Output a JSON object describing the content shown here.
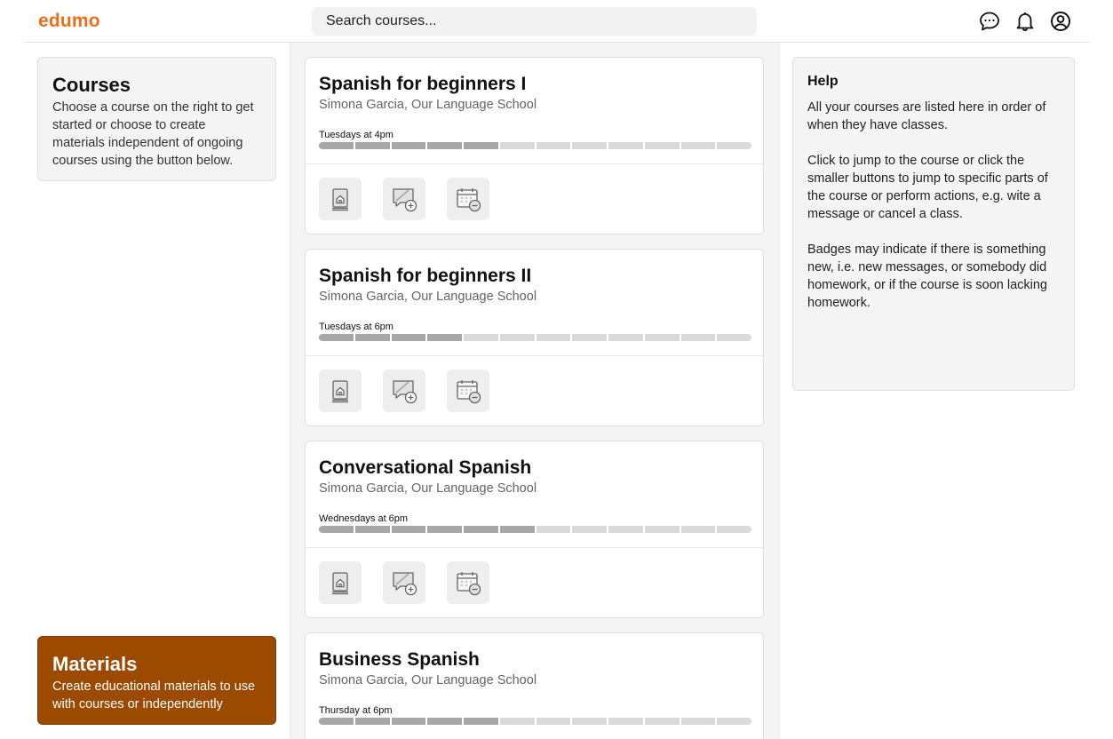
{
  "app": {
    "logo": "edumo",
    "brand_color": "#e8701a"
  },
  "search": {
    "placeholder": "Search courses..."
  },
  "header_icons": [
    "chat-icon",
    "bell-icon",
    "user-account-icon"
  ],
  "left": {
    "courses_title": "Courses",
    "courses_text": "Choose a course on the right to get started or choose to create materials independent of ongoing courses using the button below.",
    "materials_title": "Materials",
    "materials_text": "Create educational materials to use with courses or independently",
    "materials_color": "#9c4a00"
  },
  "courses": [
    {
      "title": "Spanish for beginners I",
      "subtitle": "Simona Garcia, Our Language School",
      "schedule": "Tuesdays at 4pm",
      "progress_filled": 5,
      "progress_total": 12
    },
    {
      "title": "Spanish for beginners II",
      "subtitle": "Simona Garcia, Our Language School",
      "schedule": "Tuesdays at 6pm",
      "progress_filled": 4,
      "progress_total": 12
    },
    {
      "title": "Conversational Spanish",
      "subtitle": "Simona Garcia, Our Language School",
      "schedule": "Wednesdays at 6pm",
      "progress_filled": 6,
      "progress_total": 12
    },
    {
      "title": "Business Spanish",
      "subtitle": "Simona Garcia, Our Language School",
      "schedule": "Thursday at 6pm",
      "progress_filled": 5,
      "progress_total": 12
    }
  ],
  "course_actions": [
    "course-home-icon",
    "new-message-icon",
    "cancel-class-icon"
  ],
  "help": {
    "title": "Help",
    "paragraphs": [
      "All your courses are listed here in order of when they have classes.",
      "Click to jump to the course or click the smaller buttons to jump to specific parts of the course or perform actions, e.g. wite a message or cancel a class.",
      "Badges may indicate if there is something new, i.e. new messages, or somebody did homework, or if the course is soon lacking homework."
    ]
  }
}
